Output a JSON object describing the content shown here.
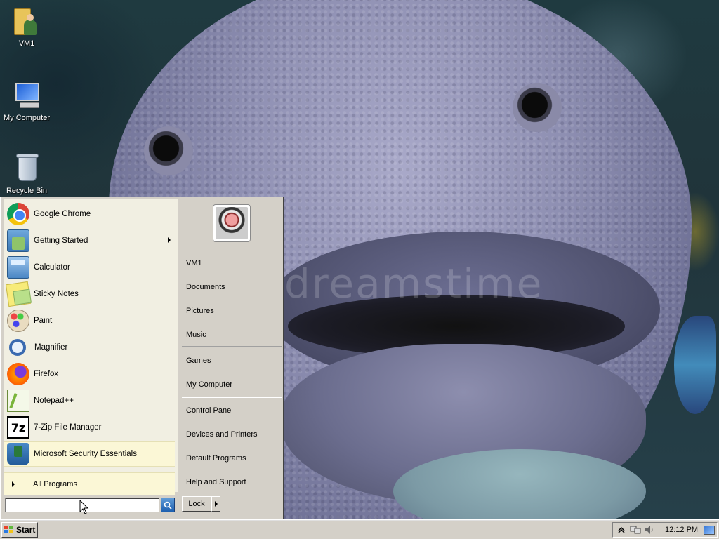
{
  "desktop": {
    "icons": [
      {
        "label": "VM1",
        "icon": "user-folder-icon"
      },
      {
        "label": "My Computer",
        "icon": "computer-icon"
      },
      {
        "label": "Recycle Bin",
        "icon": "recycle-bin-icon"
      }
    ],
    "wallpaper_watermark": "dreamstime"
  },
  "start_menu": {
    "programs": [
      {
        "label": "Google Chrome",
        "icon": "chrome-icon",
        "submenu": false
      },
      {
        "label": "Getting Started",
        "icon": "getting-started-icon",
        "submenu": true
      },
      {
        "label": "Calculator",
        "icon": "calculator-icon",
        "submenu": false
      },
      {
        "label": "Sticky Notes",
        "icon": "sticky-notes-icon",
        "submenu": false
      },
      {
        "label": "Paint",
        "icon": "paint-icon",
        "submenu": false
      },
      {
        "label": "Magnifier",
        "icon": "magnifier-icon",
        "submenu": false
      },
      {
        "label": "Firefox",
        "icon": "firefox-icon",
        "submenu": false
      },
      {
        "label": "Notepad++",
        "icon": "notepadpp-icon",
        "submenu": false
      },
      {
        "label": "7-Zip File Manager",
        "icon": "7zip-icon",
        "icon_text": "7z",
        "submenu": false
      },
      {
        "label": "Microsoft Security Essentials",
        "icon": "security-essentials-icon",
        "submenu": false,
        "highlighted": true
      }
    ],
    "all_programs_label": "All Programs",
    "search": {
      "value": "",
      "placeholder": ""
    },
    "right_links_group1": [
      "VM1",
      "Documents",
      "Pictures",
      "Music"
    ],
    "right_links_group2": [
      "Games",
      "My Computer"
    ],
    "right_links_group3": [
      "Control Panel",
      "Devices and Printers",
      "Default Programs",
      "Help and Support"
    ],
    "lock_label": "Lock"
  },
  "taskbar": {
    "start_label": "Start",
    "clock": "12:12 PM"
  }
}
